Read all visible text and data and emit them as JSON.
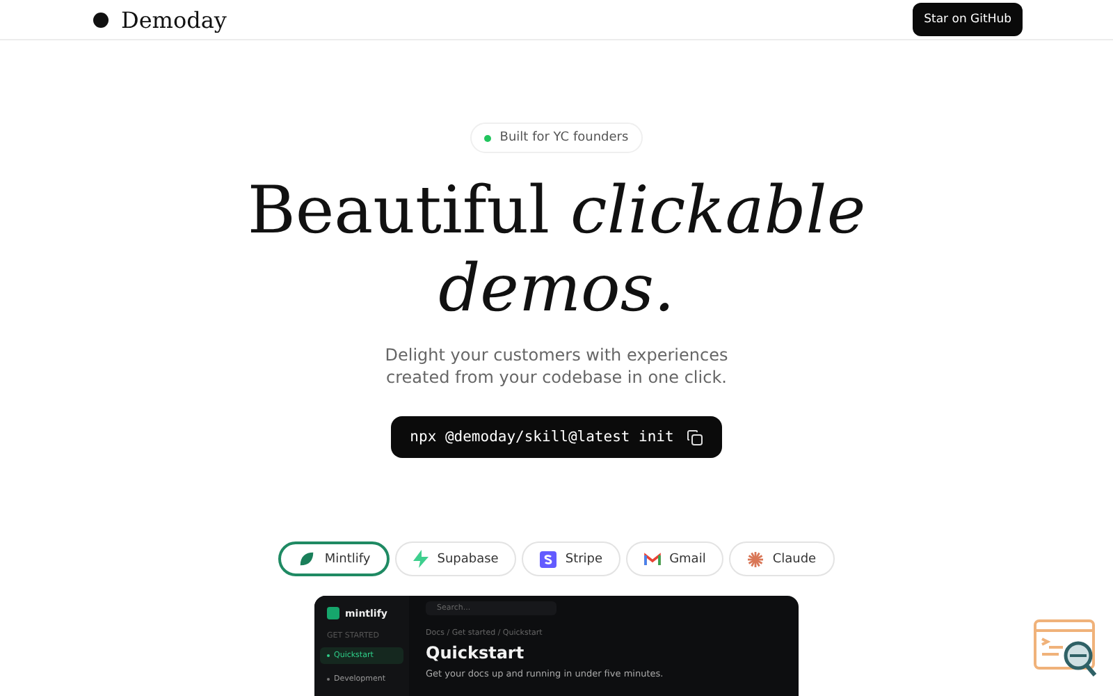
{
  "header": {
    "logo": "Demoday",
    "github_button": "Star on GitHub"
  },
  "badge": {
    "label": "Built for YC founders",
    "color": "#22c55e"
  },
  "headline": "Beautiful *clickable*\n*demos.*",
  "subtitle": "Delight your customers with experiences\ncreated from your codebase in one click.",
  "command": "npx @demoday/skill@latest init",
  "demo_tabs": [
    {
      "label": "Mintlify",
      "kind": "mintlify",
      "selected": true
    },
    {
      "label": "Supabase",
      "kind": "supabase",
      "selected": false
    },
    {
      "label": "Stripe",
      "kind": "stripe",
      "selected": false
    },
    {
      "label": "Gmail",
      "kind": "gmail",
      "selected": false
    },
    {
      "label": "Claude",
      "kind": "claude",
      "selected": false
    }
  ],
  "preview": {
    "brand": "mintlify",
    "section": "GET STARTED",
    "nav": [
      {
        "label": "Quickstart",
        "selected": true
      },
      {
        "label": "Development",
        "selected": false
      }
    ],
    "search_placeholder": "Search...",
    "breadcrumb": "Docs / Get started / Quickstart",
    "title": "Quickstart",
    "description": "Get your docs up and running in under five minutes."
  }
}
